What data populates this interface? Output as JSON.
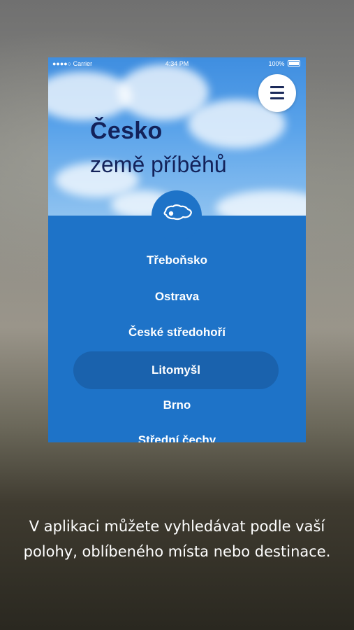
{
  "status_bar": {
    "carrier": "●●●●○ Carrier",
    "time": "4:34 PM",
    "battery": "100%"
  },
  "header": {
    "title_bold": "Česko",
    "title_light": "země příběhů"
  },
  "menu": {
    "icon": "hamburger-menu-icon"
  },
  "regions": [
    {
      "label": "Třeboňsko",
      "selected": false
    },
    {
      "label": "Ostrava",
      "selected": false
    },
    {
      "label": "České středohoří",
      "selected": false
    },
    {
      "label": "Litomyšl",
      "selected": true
    },
    {
      "label": "Brno",
      "selected": false
    },
    {
      "label": "Střední čechy",
      "selected": false
    }
  ],
  "caption": "V aplikaci můžete vyhledávat podle vaší polohy, oblíbeného místa nebo destinace.",
  "colors": {
    "panel_blue": "#1e73c8",
    "selected_pill": "#1a62ad",
    "title_navy": "#13225a"
  }
}
